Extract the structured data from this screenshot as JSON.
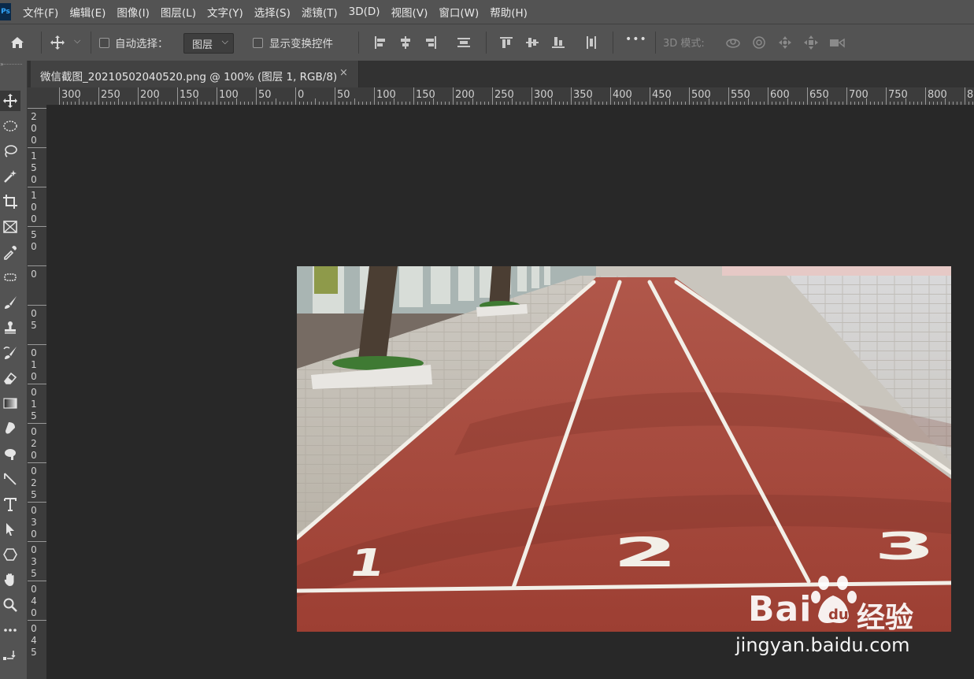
{
  "menubar": {
    "logo": "Ps",
    "items": [
      "文件(F)",
      "编辑(E)",
      "图像(I)",
      "图层(L)",
      "文字(Y)",
      "选择(S)",
      "滤镜(T)",
      "3D(D)",
      "视图(V)",
      "窗口(W)",
      "帮助(H)"
    ]
  },
  "options": {
    "auto_select_label": "自动选择：",
    "layer_select_value": "图层",
    "show_transform_label": "显示变换控件",
    "more_label": "•••",
    "mode_3d_label": "3D 模式:"
  },
  "tab": {
    "title": "微信截图_20210502040520.png @ 100% (图层 1, RGB/8)",
    "close": "×"
  },
  "hruler": {
    "labels": [
      "300",
      "250",
      "200",
      "150",
      "100",
      "50",
      "0",
      "50",
      "100",
      "150",
      "200",
      "250",
      "300",
      "350",
      "400",
      "450",
      "500",
      "550",
      "600",
      "650",
      "700",
      "750",
      "800",
      "8"
    ]
  },
  "vruler": {
    "labels": [
      "2",
      "0",
      "0",
      "1",
      "5",
      "0",
      "1",
      "0",
      "0",
      "5",
      "0",
      "0",
      "5",
      "0",
      "1",
      "0",
      "0",
      "1",
      "5",
      "0",
      "2",
      "0",
      "0",
      "2",
      "5",
      "0",
      "3",
      "0",
      "0",
      "3",
      "5",
      "0",
      "4",
      "0",
      "0",
      "4",
      "5",
      "0"
    ]
  },
  "photo": {
    "lane_numbers": [
      "1",
      "2",
      "3"
    ]
  },
  "watermark": {
    "brand": "Bai",
    "brand_suffix": "经验",
    "url": "jingyan.baidu.com"
  },
  "colors": {
    "chrome": "#535353",
    "canvas": "#282828",
    "track": "#a4473a",
    "lane_line": "#f2efe8"
  }
}
